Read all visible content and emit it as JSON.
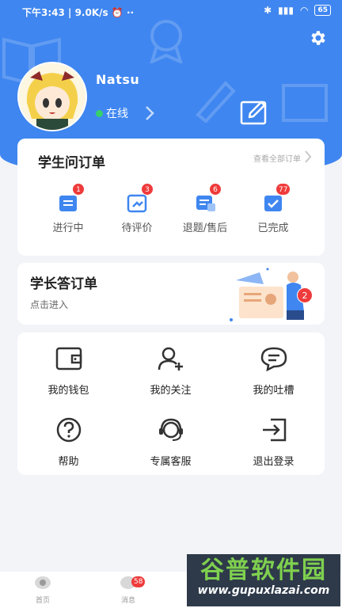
{
  "status_bar": {
    "time": "下午3:43 | 9.0K/s ⏰ ··",
    "battery": "65"
  },
  "profile": {
    "username": "Natsu",
    "status": "在线"
  },
  "question_orders": {
    "title": "学生问订单",
    "view_all": "查看全部订单",
    "items": [
      {
        "label": "进行中",
        "badge": "1"
      },
      {
        "label": "待评价",
        "badge": "3"
      },
      {
        "label": "退题/售后",
        "badge": "6"
      },
      {
        "label": "已完成",
        "badge": "77"
      }
    ]
  },
  "answer_orders": {
    "title": "学长答订单",
    "subtitle": "点击进入",
    "badge": "2"
  },
  "menu": {
    "items": [
      {
        "label": "我的钱包"
      },
      {
        "label": "我的关注"
      },
      {
        "label": "我的吐槽"
      },
      {
        "label": "帮助"
      },
      {
        "label": "专属客服"
      },
      {
        "label": "退出登录"
      }
    ]
  },
  "tabbar": {
    "home": "首页",
    "messages": "消息",
    "messages_badge": "58"
  },
  "watermark": {
    "line1": "谷普软件园",
    "line2": "www.gupuxlazai.com"
  },
  "colors": {
    "primary": "#3f86f0",
    "badge": "#ef3b3b",
    "online": "#35d06a"
  }
}
